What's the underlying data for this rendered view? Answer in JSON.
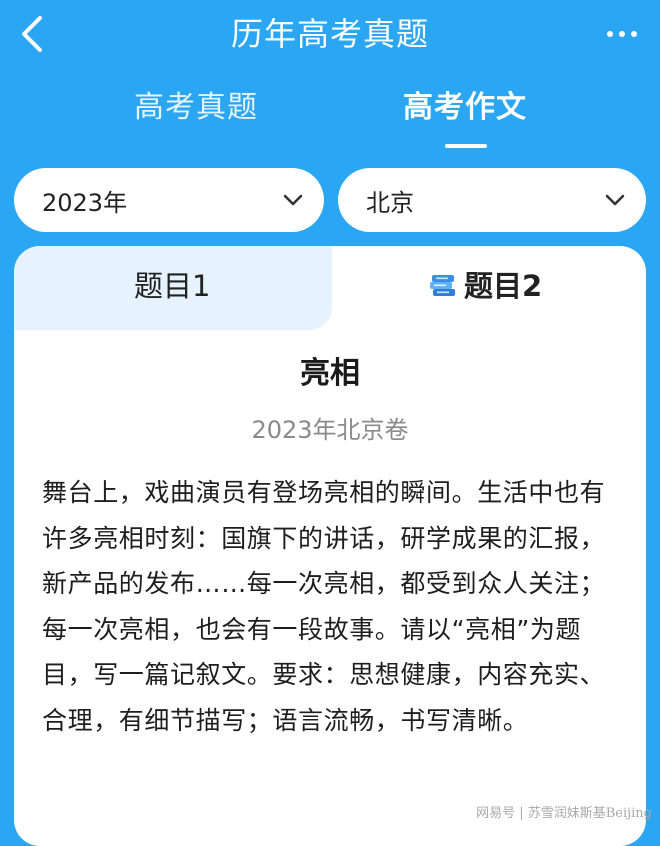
{
  "nav": {
    "title": "历年高考真题"
  },
  "tabs": [
    {
      "label": "高考真题",
      "active": false
    },
    {
      "label": "高考作文",
      "active": true
    }
  ],
  "filters": {
    "year": "2023年",
    "region": "北京"
  },
  "question_tabs": [
    {
      "label": "题目1",
      "active": false
    },
    {
      "label": "题目2",
      "active": true
    }
  ],
  "essay": {
    "title": "亮相",
    "source": "2023年北京卷",
    "prompt": "舞台上，戏曲演员有登场亮相的瞬间。生活中也有许多亮相时刻：国旗下的讲话，研学成果的汇报，新产品的发布……每一次亮相，都受到众人关注；每一次亮相，也会有一段故事。请以“亮相”为题目，写一篇记叙文。要求：思想健康，内容充实、合理，有细节描写；语言流畅，书写清晰。"
  },
  "watermark": "网易号 | 苏雪润妹斯基Beijing",
  "colors": {
    "primary": "#2aa6f2",
    "tab_inactive_bg": "#e6f2fd",
    "text": "#1e1e1e",
    "muted": "#8a8a8a"
  },
  "icons": {
    "back": "chevron-left-icon",
    "more": "more-dots-icon",
    "dropdown": "chevron-down-icon",
    "question": "document-stack-icon"
  }
}
